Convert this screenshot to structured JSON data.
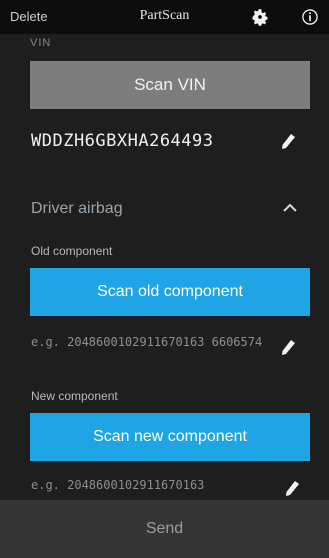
{
  "nav": {
    "left_label": "Delete",
    "title": "PartScan",
    "icons": [
      "gear-icon",
      "info-icon"
    ]
  },
  "vin": {
    "cut_label": "VIN",
    "scan_label": "Scan VIN",
    "value": "WDDZH6GBXHA264493"
  },
  "section": {
    "title": "Driver airbag",
    "old": {
      "label": "Old component",
      "button": "Scan old component",
      "example": "e.g. 2048600102911670163 6606574"
    },
    "new": {
      "label": "New component",
      "button": "Scan new component",
      "example": "e.g. 2048600102911670163"
    }
  },
  "send_label": "Send",
  "colors": {
    "accent": "#1fa4e6",
    "gray_button": "#7d7d7d",
    "background": "#1e1e1e"
  }
}
